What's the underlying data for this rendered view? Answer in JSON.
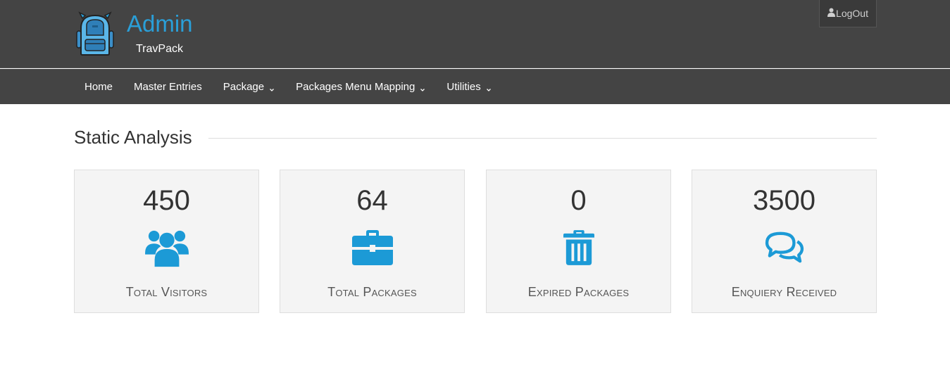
{
  "brand": {
    "title": "Admin",
    "subtitle": "TravPack",
    "logo_icon": "backpack-icon"
  },
  "header": {
    "logout_label": "LogOut",
    "logout_icon": "user-icon"
  },
  "nav": {
    "items": [
      {
        "label": "Home",
        "dropdown": false
      },
      {
        "label": "Master Entries",
        "dropdown": false
      },
      {
        "label": "Package",
        "dropdown": true
      },
      {
        "label": "Packages Menu Mapping",
        "dropdown": true
      },
      {
        "label": "Utilities",
        "dropdown": true
      }
    ]
  },
  "section": {
    "title": "Static Analysis"
  },
  "stats": [
    {
      "count": "450",
      "label": "Total Visitors",
      "icon": "users-icon"
    },
    {
      "count": "64",
      "label": "Total Packages",
      "icon": "briefcase-icon"
    },
    {
      "count": "0",
      "label": "Expired Packages",
      "icon": "trash-icon"
    },
    {
      "count": "3500",
      "label": "Enquiery Received",
      "icon": "comments-icon"
    }
  ],
  "colors": {
    "header_bg": "#444444",
    "accent": "#1c9ad6",
    "brand": "#2a9fd8",
    "card_bg": "#f4f4f4"
  }
}
